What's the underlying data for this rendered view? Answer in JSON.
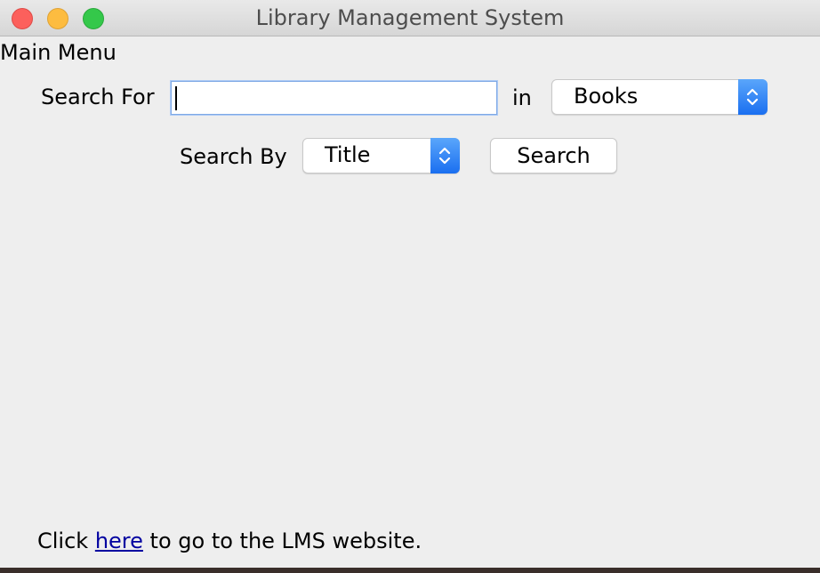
{
  "window": {
    "title": "Library Management System"
  },
  "menu": {
    "label": "Main Menu"
  },
  "search": {
    "search_for_label": "Search For",
    "query_value": "",
    "in_label": "in",
    "category_selected": "Books",
    "search_by_label": "Search By",
    "field_selected": "Title",
    "search_button_label": "Search"
  },
  "footer": {
    "prefix": "Click ",
    "link_text": "here",
    "suffix": " to go to the LMS website."
  }
}
